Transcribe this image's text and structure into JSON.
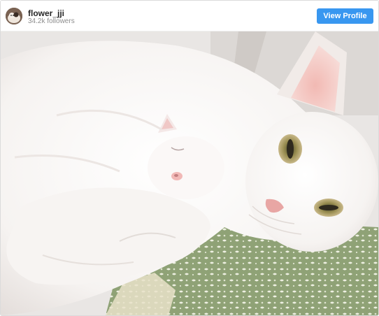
{
  "header": {
    "username": "flower_jji",
    "followers": "34.2k followers",
    "view_profile_label": "View Profile"
  },
  "colors": {
    "button_blue": "#3897f0",
    "username_text": "#262626",
    "muted_text": "#8e8e8e"
  },
  "icons": {
    "avatar": "profile-avatar-cat"
  }
}
